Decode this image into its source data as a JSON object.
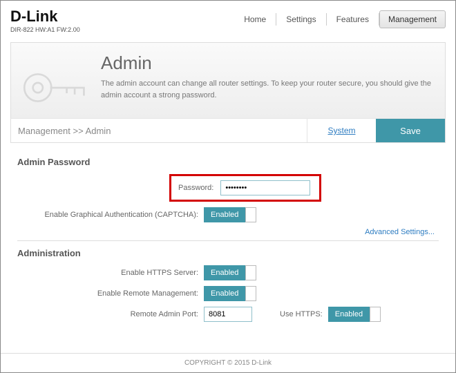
{
  "header": {
    "brand": "D-Link",
    "model": "DIR-822 HW:A1 FW:2.00",
    "nav": [
      "Home",
      "Settings",
      "Features",
      "Management"
    ]
  },
  "banner": {
    "title": "Admin",
    "desc": "The admin account can change all router settings. To keep your router secure, you should give the admin account a strong password."
  },
  "crumb": {
    "path": "Management >> Admin",
    "system": "System",
    "save": "Save"
  },
  "sections": {
    "adminPassword": {
      "title": "Admin Password",
      "passwordLabel": "Password:",
      "passwordValue": "••••••••",
      "captchaLabel": "Enable Graphical Authentication (CAPTCHA):",
      "captchaState": "Enabled"
    },
    "advancedLink": "Advanced Settings...",
    "administration": {
      "title": "Administration",
      "httpsServerLabel": "Enable HTTPS Server:",
      "httpsServerState": "Enabled",
      "remoteMgmtLabel": "Enable Remote Management:",
      "remoteMgmtState": "Enabled",
      "remotePortLabel": "Remote Admin Port:",
      "remotePortValue": "8081",
      "useHttpsLabel": "Use HTTPS:",
      "useHttpsState": "Enabled"
    }
  },
  "footer": {
    "copyright": "COPYRIGHT © 2015 D-Link"
  }
}
